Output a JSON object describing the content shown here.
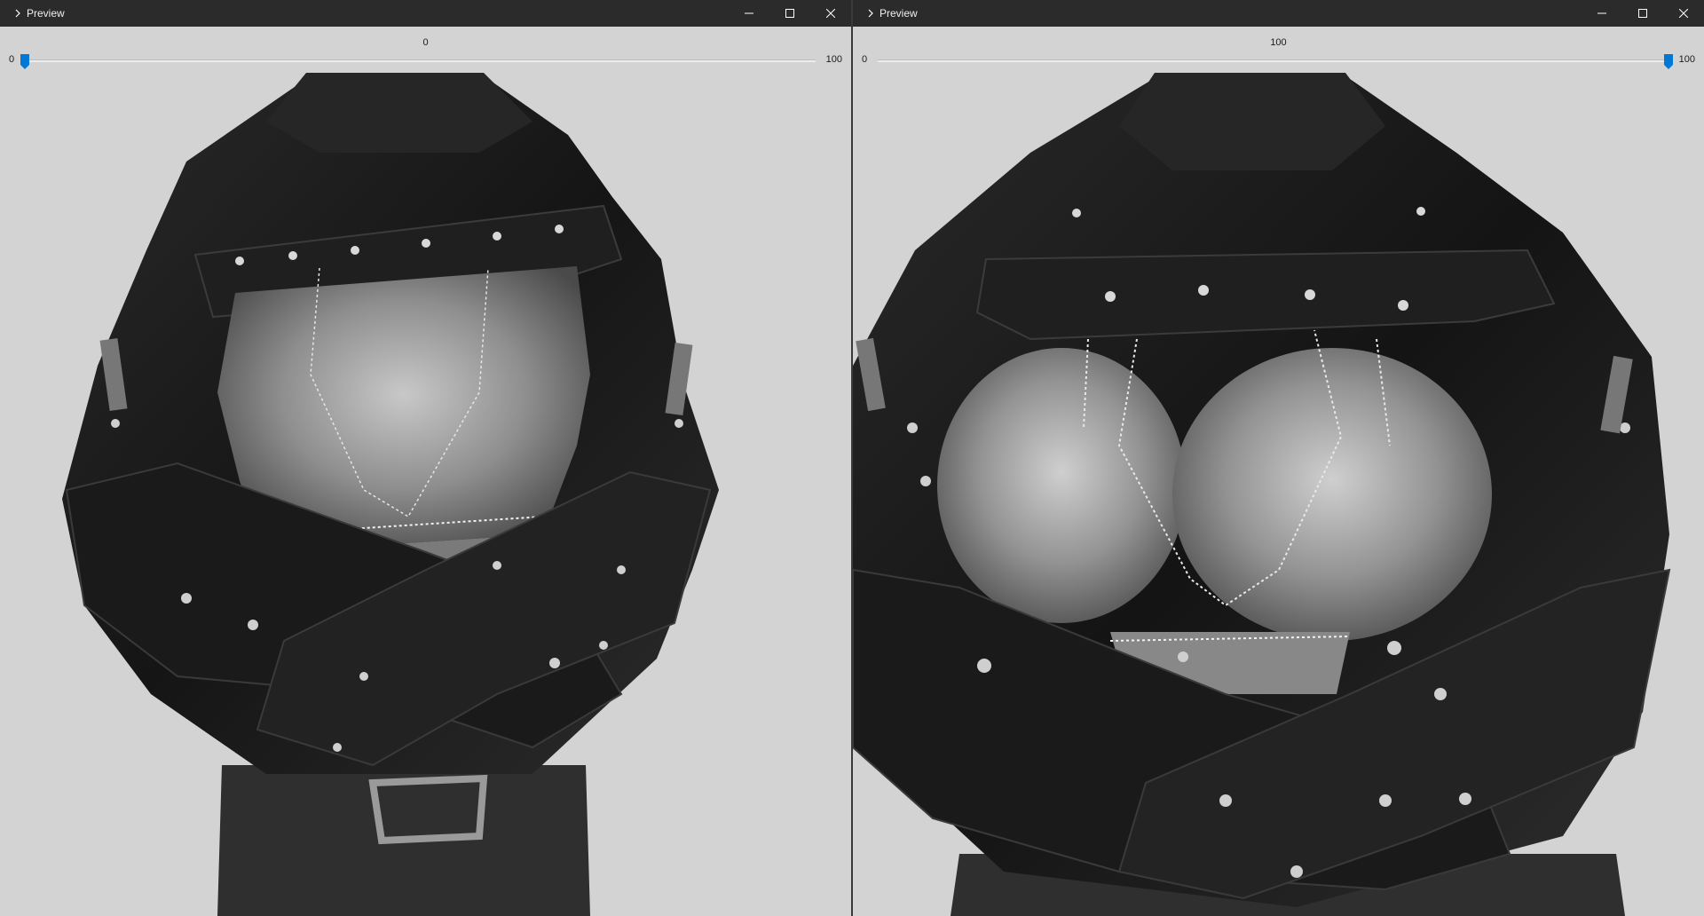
{
  "windows": [
    {
      "title": "Preview",
      "app_icon": "chevron-right-icon",
      "slider": {
        "value": "0",
        "min_label": "0",
        "max_label": "100",
        "fraction": 0.0
      }
    },
    {
      "title": "Preview",
      "app_icon": "chevron-right-icon",
      "slider": {
        "value": "100",
        "min_label": "0",
        "max_label": "100",
        "fraction": 1.0
      }
    }
  ],
  "caption_icons": [
    "minimize-icon",
    "maximize-icon",
    "close-icon"
  ],
  "colors": {
    "titlebar": "#2b2b2b",
    "background": "#d3d3d3",
    "accent": "#0078d7",
    "leather": "#1c1c1c",
    "metal": "#8e8e8e"
  }
}
